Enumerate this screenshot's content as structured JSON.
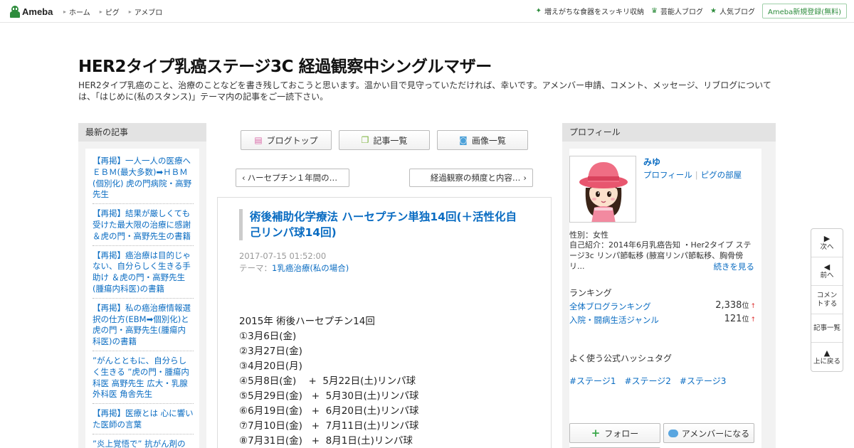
{
  "topbar": {
    "logo_text": "Ameba",
    "nav": [
      {
        "label": "ホーム"
      },
      {
        "label": "ピグ"
      },
      {
        "label": "アメブロ"
      }
    ],
    "right": [
      {
        "icon": "sparkle-icon",
        "label": "増えがちな食器をスッキリ収納"
      },
      {
        "icon": "crown-icon",
        "label": "芸能人ブログ"
      },
      {
        "icon": "star-icon",
        "label": "人気ブログ"
      }
    ],
    "register_label": "Ameba新規登録(無料)",
    "accent_color": "#2d8c3c"
  },
  "header": {
    "title": "HER2タイプ乳癌ステージ3C 経過観察中シングルマザー",
    "description": "HER2タイプ乳癌のこと、治療のことなどを書き残しておこうと思います。温かい目で見守っていただければ、幸いです。アメンバー申請、コメント、メッセージ、リブログについては、「はじめに(私のスタンス)」テーマ内の記事をご一読下さい。"
  },
  "recent": {
    "heading": "最新の記事",
    "items": [
      {
        "title": "【再掲】一人一人の医療へ ＥＢＭ(最大多数)➡ＨＢＭ(個別化) 虎の門病院・高野先生"
      },
      {
        "title": "【再掲】結果が厳しくても受けた最大限の治療に感謝 ＆虎の門・高野先生の書籍"
      },
      {
        "title": "【再掲】癌治療は目的じゃない、自分らしく生きる手助け ＆虎の門・高野先生(腫瘍内科医)の書籍"
      },
      {
        "title": "【再掲】私の癌治療情報選択の仕方(EBM➡個別化)と虎の門・高野先生(腫瘍内科医)の書籍"
      },
      {
        "title": "”がんとともに、自分らしく生きる ”虎の門・腫瘍内科医 高野先生 広大・乳腺外科医 角舎先生"
      },
      {
        "title": "【再掲】医療とは 心に響いた医師の言葉"
      },
      {
        "title": "”炎上覚悟で” 抗がん剤の"
      }
    ]
  },
  "center": {
    "nav_buttons": [
      {
        "icon": "document-icon",
        "label": "ブログトップ"
      },
      {
        "icon": "copy-icon",
        "label": "記事一覧"
      },
      {
        "icon": "camera-icon",
        "label": "画像一覧"
      }
    ],
    "prev_label": "ハーセプチン１年間の…",
    "next_label": "経過観察の頻度と内容…",
    "article": {
      "title": "術後補助化学療法 ハーセプチン単独14回(＋活性化自己リンパ球14回)",
      "date": "2017-07-15 01:52:00",
      "theme_prefix": "テーマ：",
      "theme": "1乳癌治療(私の場合)",
      "lines": [
        "2015年  術後ハーセプチン14回",
        "①3月6日(金)",
        "②3月27日(金)",
        "③4月20日(月)",
        "④5月8日(金)    +  5月22日(土)リンパ球",
        "⑤5月29日(金)   +  5月30日(土)リンパ球",
        "⑥6月19日(金)   +  6月20日(土)リンパ球",
        "⑦7月10日(金)   +  7月11日(土)リンパ球",
        "⑧7月31日(金)   +  8月1日(土)リンパ球"
      ]
    }
  },
  "profile": {
    "heading": "プロフィール",
    "name": "みゆ",
    "link_profile": "プロフィール",
    "link_room": "ピグの部屋",
    "gender": "性別：女性",
    "intro": "自己紹介：2014年6月乳癌告知 ・Her2タイプ ステージ3c リンパ節転移 (腋窩リンパ節転移、胸骨傍リ...",
    "more_label": "続きを見る",
    "ranking_heading": "ランキング",
    "rankings": [
      {
        "label": "全体ブログランキング",
        "value": "2,338",
        "unit": "位",
        "trend": "↑"
      },
      {
        "label": "入院・闘病生活ジャンル",
        "value": "121",
        "unit": "位",
        "trend": "↑"
      }
    ],
    "hashtag_heading": "よく使う公式ハッシュタグ",
    "hashtags": [
      "#ステージ1",
      "#ステージ2",
      "#ステージ3"
    ],
    "follow_label": "フォロー",
    "member_label": "アメンバーになる"
  },
  "sidenav": [
    {
      "icon": "triangle-right-icon",
      "glyph": "▶",
      "label": "次へ"
    },
    {
      "icon": "triangle-left-icon",
      "glyph": "◀",
      "label": "前へ"
    },
    {
      "icon": "",
      "glyph": "",
      "label": "コメントする"
    },
    {
      "icon": "",
      "glyph": "",
      "label": "記事一覧"
    },
    {
      "icon": "triangle-up-icon",
      "glyph": "▲",
      "label": "上に戻る"
    }
  ]
}
